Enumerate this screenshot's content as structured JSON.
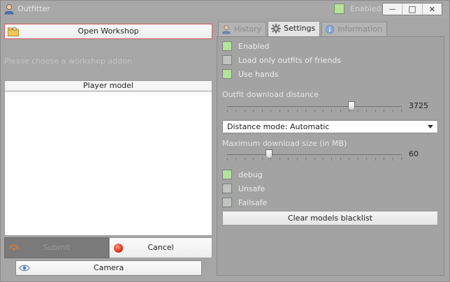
{
  "window": {
    "title": "Outfitter",
    "enabled_label": "Enabled",
    "minimize_glyph": "—",
    "maximize_glyph": "□",
    "close_glyph": "✕"
  },
  "left": {
    "open_workshop_label": "Open Workshop",
    "choose_hint": "Please choose a workshop addon",
    "model_header": "Player model",
    "submit_label": "Submit",
    "cancel_label": "Cancel",
    "camera_label": "Camera"
  },
  "tabs": [
    {
      "label": "History",
      "icon": "user-icon",
      "active": false
    },
    {
      "label": "Settings",
      "icon": "gear-icon",
      "active": true
    },
    {
      "label": "Information",
      "icon": "info-icon",
      "active": false
    }
  ],
  "settings": {
    "checks_top": [
      {
        "label": "Enabled",
        "checked": true
      },
      {
        "label": "Load only outfits of friends",
        "checked": false
      },
      {
        "label": "Use hands",
        "checked": true
      }
    ],
    "distance_label": "Outfit download distance",
    "distance_value": "3725",
    "distance_fraction": 0.71,
    "distance_mode": "Distance mode: Automatic",
    "max_size_label": "Maximum download size (in MB)",
    "max_size_value": "60",
    "max_size_fraction": 0.24,
    "checks_bottom": [
      {
        "label": "debug",
        "checked": true
      },
      {
        "label": "Unsafe",
        "checked": false
      },
      {
        "label": "Failsafe",
        "checked": false
      }
    ],
    "clear_label": "Clear models blacklist"
  },
  "colors": {
    "check_on": "#b4e39b",
    "check_off": "#bdc5bd",
    "window_bg": "#a6a6a6"
  }
}
